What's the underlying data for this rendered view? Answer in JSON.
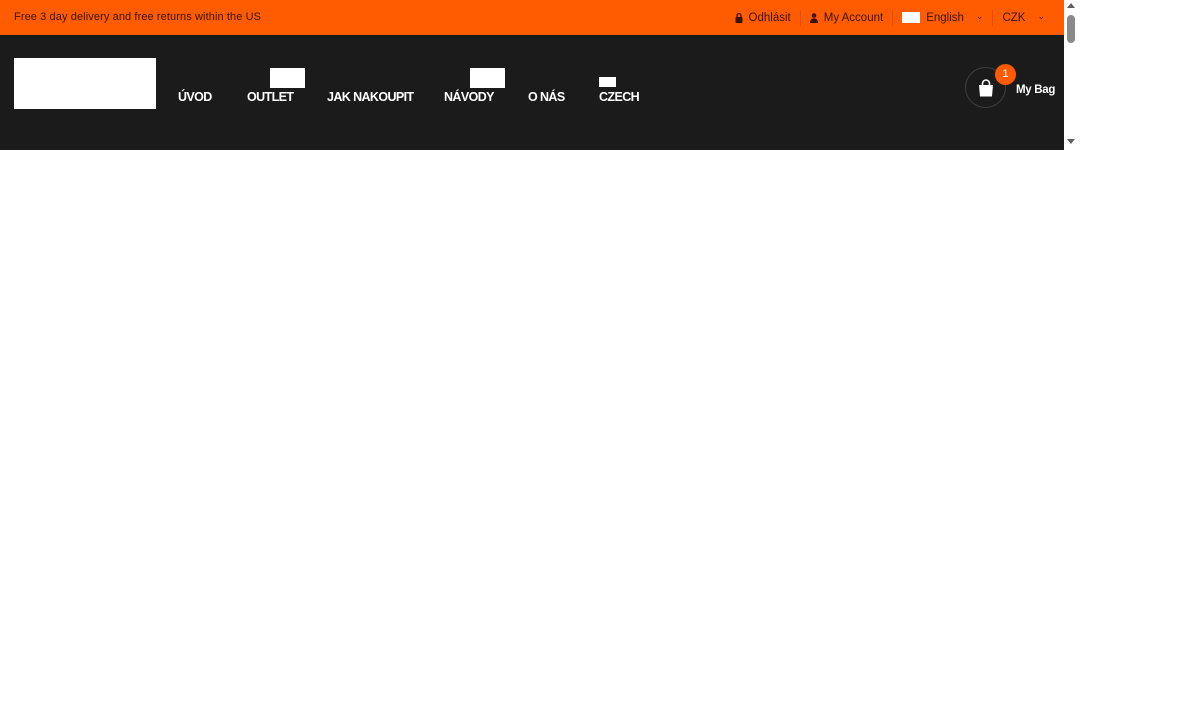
{
  "topbar": {
    "promo": "Free 3 day delivery and free returns within the US",
    "logout_label": "Odhlásit",
    "account_label": "My Account",
    "language_label": "English",
    "currency_label": "CZK",
    "background": "#ff5b00"
  },
  "header": {
    "background": "#1b1b1b",
    "nav": [
      {
        "label": "ÚVOD"
      },
      {
        "label": "OUTLET"
      },
      {
        "label": "JAK NAKOUPIT"
      },
      {
        "label": "NÁVODY"
      },
      {
        "label": "O NÁS"
      },
      {
        "label": "CZECH"
      }
    ],
    "cart": {
      "count": "1",
      "label": "My Bag",
      "badge_color": "#ff5b00"
    }
  },
  "icons": {
    "lock": "lock-icon",
    "user": "user-icon",
    "flag": "flag-icon",
    "chevron": "chevron-down-icon",
    "bag": "shopping-bag-icon"
  }
}
